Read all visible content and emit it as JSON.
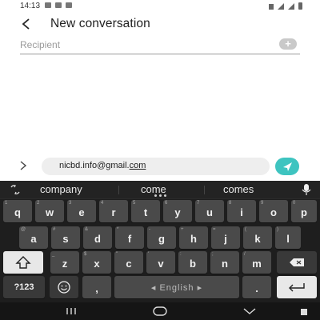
{
  "status": {
    "time": "14:13"
  },
  "header": {
    "title": "New conversation"
  },
  "recipient": {
    "placeholder": "Recipient",
    "add_label": "+"
  },
  "compose": {
    "text_main": "nicbd.info@gmail.",
    "text_underlined": "com"
  },
  "keyboard": {
    "suggestions": [
      "company",
      "come",
      "comes"
    ],
    "row1": [
      {
        "main": "q",
        "hint": "1"
      },
      {
        "main": "w",
        "hint": "2"
      },
      {
        "main": "e",
        "hint": "3"
      },
      {
        "main": "r",
        "hint": "4"
      },
      {
        "main": "t",
        "hint": "5"
      },
      {
        "main": "y",
        "hint": "6"
      },
      {
        "main": "u",
        "hint": "7"
      },
      {
        "main": "i",
        "hint": "8"
      },
      {
        "main": "o",
        "hint": "9"
      },
      {
        "main": "p",
        "hint": "0"
      }
    ],
    "row2": [
      {
        "main": "a",
        "hint": "@"
      },
      {
        "main": "s",
        "hint": "#"
      },
      {
        "main": "d",
        "hint": "&"
      },
      {
        "main": "f",
        "hint": "*"
      },
      {
        "main": "g",
        "hint": "-"
      },
      {
        "main": "h",
        "hint": "+"
      },
      {
        "main": "j",
        "hint": "="
      },
      {
        "main": "k",
        "hint": "("
      },
      {
        "main": "l",
        "hint": ")"
      }
    ],
    "row3": [
      {
        "main": "z",
        "hint": "_"
      },
      {
        "main": "x",
        "hint": "$"
      },
      {
        "main": "c",
        "hint": "\""
      },
      {
        "main": "v",
        "hint": "'"
      },
      {
        "main": "b",
        "hint": ":"
      },
      {
        "main": "n",
        "hint": ";"
      },
      {
        "main": "m",
        "hint": "/"
      }
    ],
    "symbols_label": "?123",
    "comma": ",",
    "space_label": "◂  English  ▸",
    "period": "."
  }
}
